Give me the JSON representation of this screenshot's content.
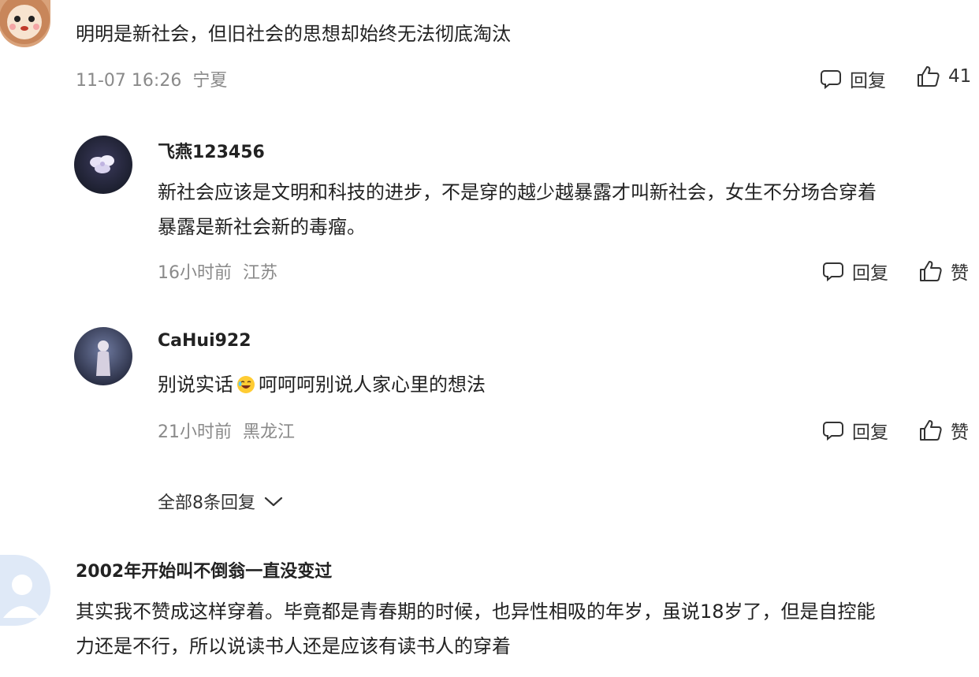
{
  "comments": [
    {
      "text_lines": [
        "明明是新社会，但旧社会的思想却始终无法彻底淘汰"
      ],
      "time": "11-07 16:26",
      "location": "宁夏",
      "reply_label": "回复",
      "like_label": "41",
      "avatar_icon": "cartoon-lion-avatar",
      "replies": [
        {
          "username": "飞燕123456",
          "text_lines": [
            "新社会应该是文明和科技的进步，不是穿的越少越暴露才叫新社会，女生不分场合穿着",
            "暴露是新社会新的毒瘤。"
          ],
          "time": "16小时前",
          "location": "江苏",
          "reply_label": "回复",
          "like_label": "赞",
          "avatar_icon": "flower-avatar"
        },
        {
          "username": "CaHui922",
          "text_before_emoji": "别说实话",
          "emoji_icon": "rofl-emoji-icon",
          "text_after_emoji": "呵呵呵别说人家心里的想法",
          "time": "21小时前",
          "location": "黑龙江",
          "reply_label": "回复",
          "like_label": "赞",
          "avatar_icon": "person-photo-avatar"
        }
      ],
      "expand_label": "全部8条回复"
    },
    {
      "username": "2002年开始叫不倒翁一直没变过",
      "text_lines": [
        "其实我不赞成这样穿着。毕竟都是青春期的时候，也异性相吸的年岁，虽说18岁了，但是自控能",
        "力还是不行，所以说读书人还是应该有读书人的穿着"
      ],
      "avatar_icon": "default-user-avatar"
    }
  ],
  "colors": {
    "text": "#222222",
    "meta": "#8a8a8a",
    "background": "#ffffff"
  }
}
